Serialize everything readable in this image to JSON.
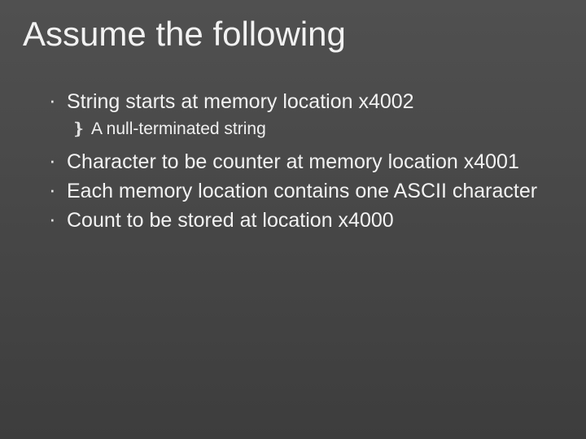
{
  "slide": {
    "title": "Assume the following",
    "items": [
      {
        "text": "String starts at memory location x4002",
        "sub": [
          {
            "text": "A null-terminated string"
          }
        ]
      },
      {
        "text": "Character to be counter at memory location x4001",
        "sub": []
      },
      {
        "text": "Each memory location contains one ASCII character",
        "sub": []
      },
      {
        "text": "Count to be stored at location x4000",
        "sub": []
      }
    ]
  },
  "bullets": {
    "level1": "·",
    "level2": "❵"
  }
}
